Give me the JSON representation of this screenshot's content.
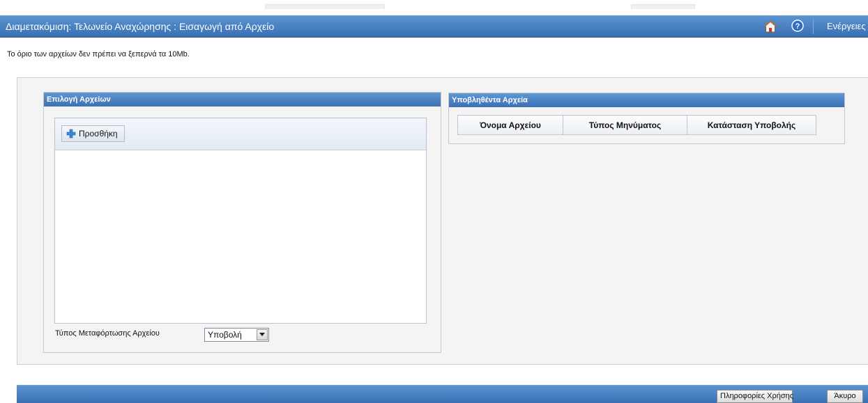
{
  "header": {
    "title": "Διαμετακόμιση: Τελωνείο Αναχώρησης : Εισαγωγή από Αρχείο",
    "home_icon": "home-icon",
    "help_icon": "help-icon",
    "actions_label": "Ενέργειες"
  },
  "notice": "Το όριο των αρχείων δεν πρέπει να ξεπερνά τα 10Mb.",
  "file_selection": {
    "title": "Επιλογή Αρχείων",
    "add_button_label": "Προσθήκη",
    "add_icon": "plus-icon",
    "upload_type_label": "Τύπος Μεταφόρτωσης Αρχείου",
    "upload_type_value": "Υποβολή"
  },
  "submitted_files": {
    "title": "Υποβληθέντα Αρχεία",
    "columns": [
      "Όνομα Αρχείου",
      "Τύπος Μηνύματος",
      "Κατάσταση Υποβολής"
    ]
  },
  "footer": {
    "info_button": "Πληροφορίες Χρήσης",
    "cancel_button": "Άκυρο"
  },
  "colors": {
    "header_blue": "#3a70b3",
    "panel_bg": "#f4f4f4"
  }
}
